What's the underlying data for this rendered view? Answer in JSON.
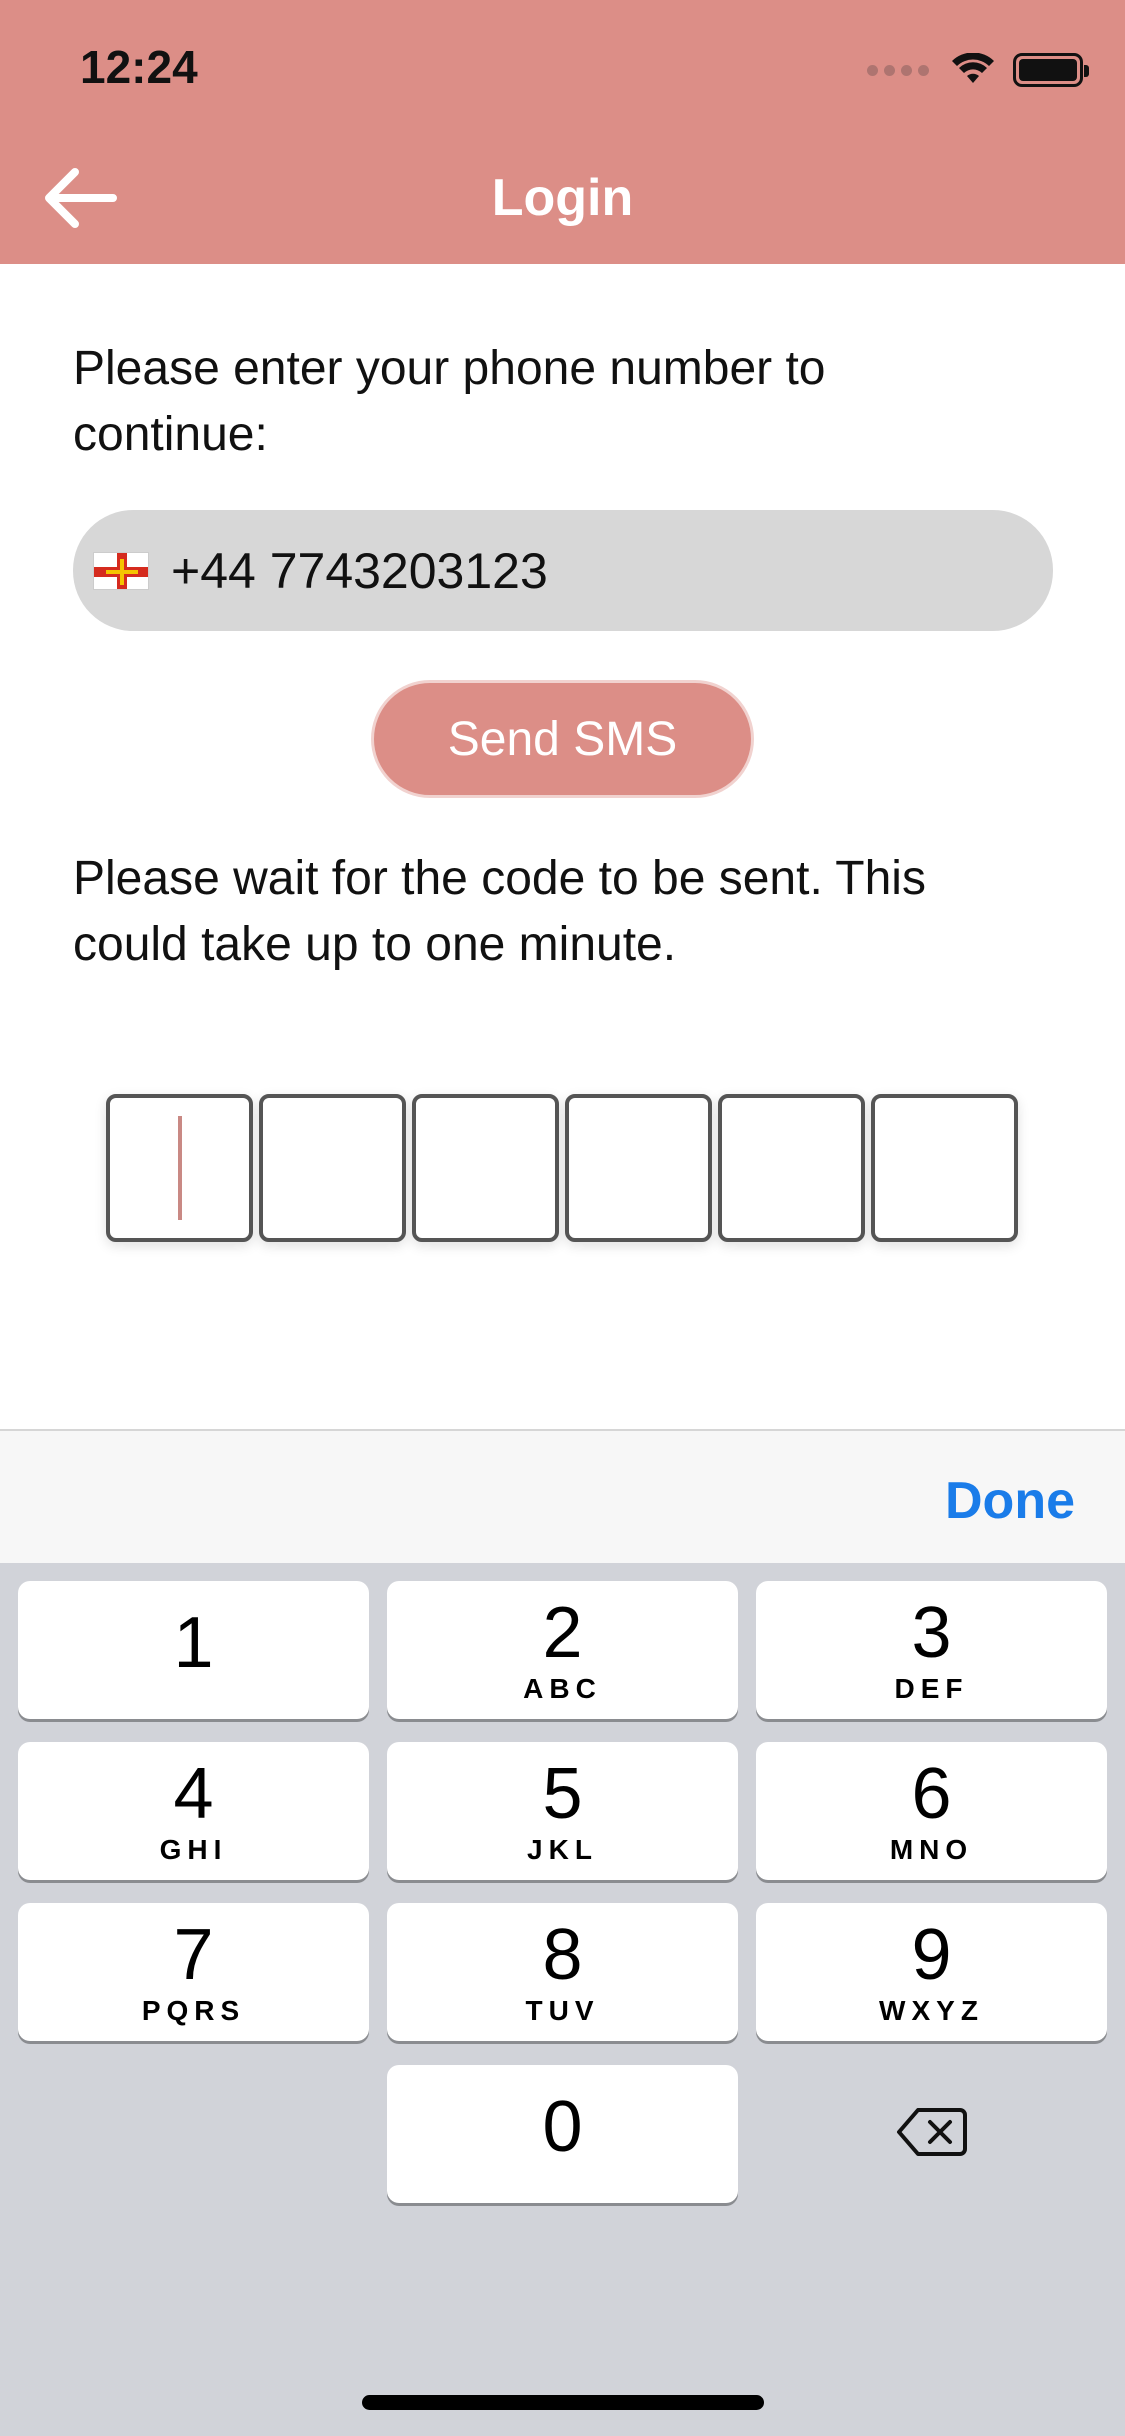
{
  "status_bar": {
    "time": "12:24"
  },
  "header": {
    "title": "Login",
    "back_icon": "arrow-left-icon",
    "color": "#dc8e87"
  },
  "prompt_text": "Please enter your phone number to continue:",
  "phone": {
    "flag": "guernsey-flag-icon",
    "value": "+44 7743203123"
  },
  "send_button": {
    "label": "Send SMS"
  },
  "wait_text": "Please wait for the code to be sent. This could take up to one minute.",
  "code_input": {
    "length": 6,
    "values": [
      "",
      "",
      "",
      "",
      "",
      ""
    ]
  },
  "keyboard_toolbar": {
    "done_label": "Done",
    "done_color": "#1a7ce9"
  },
  "keypad": {
    "keys": [
      {
        "digit": "1",
        "letters": ""
      },
      {
        "digit": "2",
        "letters": "ABC"
      },
      {
        "digit": "3",
        "letters": "DEF"
      },
      {
        "digit": "4",
        "letters": "GHI"
      },
      {
        "digit": "5",
        "letters": "JKL"
      },
      {
        "digit": "6",
        "letters": "MNO"
      },
      {
        "digit": "7",
        "letters": "PQRS"
      },
      {
        "digit": "8",
        "letters": "TUV"
      },
      {
        "digit": "9",
        "letters": "WXYZ"
      },
      {
        "digit": "0",
        "letters": ""
      }
    ],
    "delete_icon": "backspace-icon"
  }
}
